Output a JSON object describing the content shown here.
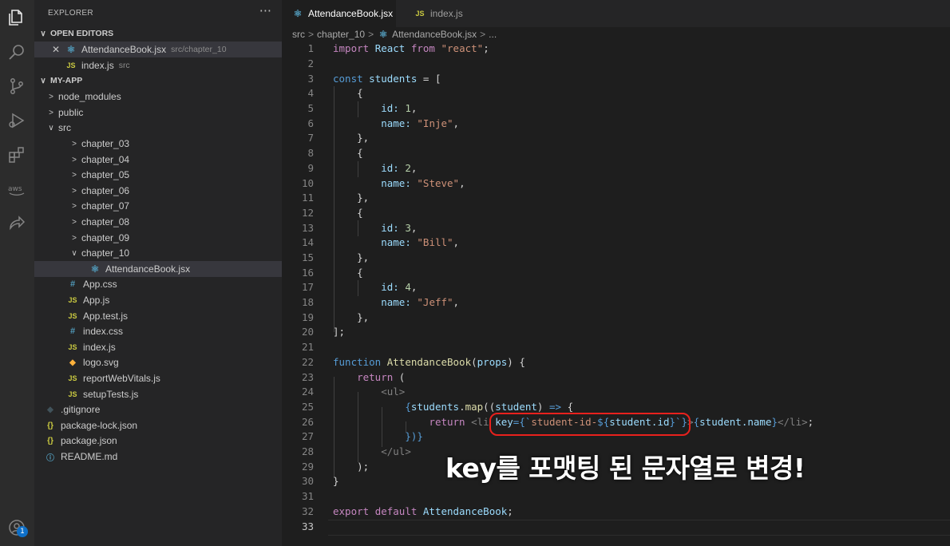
{
  "sidebar": {
    "header": "EXPLORER",
    "more": "···",
    "open_editors_title": "OPEN EDITORS",
    "open_editors": [
      {
        "name": "AttendanceBook.jsx",
        "desc": "src/chapter_10"
      },
      {
        "name": "index.js",
        "desc": "src"
      }
    ],
    "project_title": "MY-APP",
    "tree": [
      "node_modules",
      "public",
      "src",
      "chapter_03",
      "chapter_04",
      "chapter_05",
      "chapter_06",
      "chapter_07",
      "chapter_08",
      "chapter_09",
      "chapter_10",
      "AttendanceBook.jsx",
      "App.css",
      "App.js",
      "App.test.js",
      "index.css",
      "index.js",
      "logo.svg",
      "reportWebVitals.js",
      "setupTests.js",
      ".gitignore",
      "package-lock.json",
      "package.json",
      "README.md"
    ]
  },
  "tabs": [
    "AttendanceBook.jsx",
    "index.js"
  ],
  "breadcrumb": [
    "src",
    "chapter_10",
    "AttendanceBook.jsx",
    "..."
  ],
  "icons": {
    "js": "JS",
    "css": "#",
    "json": "{}"
  },
  "account_badge": "1",
  "editor": {
    "line_numbers": [
      "1",
      "2",
      "3",
      "4",
      "5",
      "6",
      "7",
      "8",
      "9",
      "10",
      "11",
      "12",
      "13",
      "14",
      "15",
      "16",
      "17",
      "18",
      "19",
      "20",
      "21",
      "22",
      "23",
      "24",
      "25",
      "26",
      "27",
      "28",
      "29",
      "30",
      "31",
      "32",
      "33"
    ],
    "tokens": {
      "import": "import",
      "react": "React",
      "from": "from",
      "react_str": "\"react\"",
      "semi": ";",
      "const": "const",
      "students": "students",
      "eq_open": " = [",
      "open_brace": "{",
      "close_brace_comma": "},",
      "close_bracket_semi": "];",
      "id_key": "id:",
      "name_key": "name:",
      "comma": ",",
      "id1": "1",
      "name1": "\"Inje\"",
      "id2": "2",
      "name2": "\"Steve\"",
      "id3": "3",
      "name3": "\"Bill\"",
      "id4": "4",
      "name4": "\"Jeff\"",
      "function": "function",
      "fn_name": "AttendanceBook",
      "props": "props",
      "paren_open": "(",
      "paren_close_brace": ") {",
      "return": "return",
      "return_paren": " (",
      "ul_open": "<ul>",
      "ul_close": "</ul>",
      "brace": "{",
      "map": "map",
      "student": "student",
      "arrow": "=>",
      "li_open": "<li",
      "key_attr": "key",
      "key_eq": "={`",
      "tmpl_str": "student-id-",
      "interp_open": "${",
      "student_id": "student.id",
      "interp_close": "}",
      "tmpl_end": "`}",
      "gt": ">",
      "student_name": "student.name",
      "li_close": "</li>",
      "close_map": "})}",
      "close_paren_semi": ");",
      "close_brace": "}",
      "export": "export",
      "default": "default"
    }
  },
  "overlay_caption": "key를 포맷팅 된 문자열로 변경!"
}
